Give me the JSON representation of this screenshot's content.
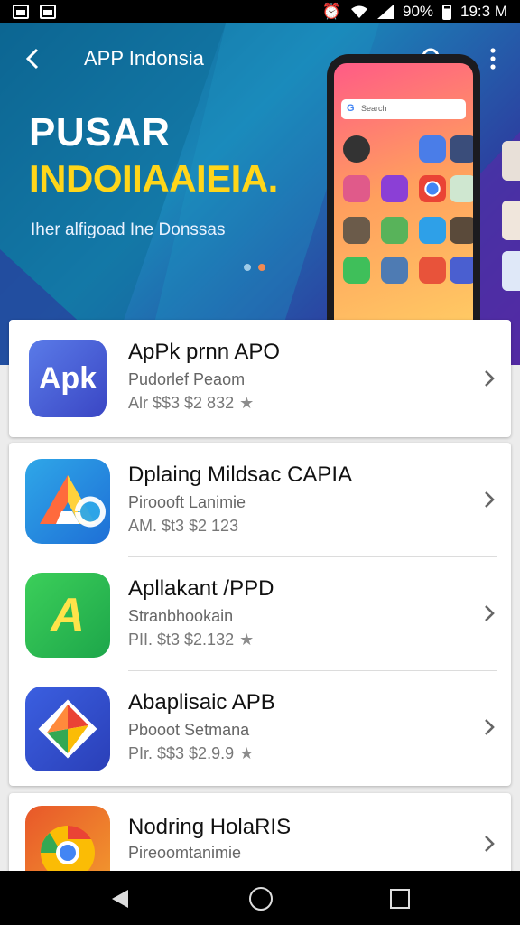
{
  "status_bar": {
    "battery": "90%",
    "time": "19:3 M"
  },
  "header": {
    "title": "APP Indonsia",
    "headline_line1": "PUSAR",
    "headline_line2": "INDOIIAAIEIA.",
    "tagline": "Iher alfigoad Ine Donssas",
    "slide_count": 2,
    "active_slide": 1
  },
  "phone": {
    "search_text": "Search"
  },
  "colors": {
    "headline_yellow": "#ffd61a",
    "dot_active": "#f08a52",
    "dot_inactive": "#9ecbe8"
  },
  "apps": [
    {
      "name": "ApPk prnn APO",
      "subtitle": "Pudorlef Peaom",
      "meta": "Alr $$3 $2 832",
      "rating_icon": "star-icon",
      "icon": "apk-icon",
      "icon_text": "Apk"
    },
    {
      "name": "Dplaing Mildsac CAPIA",
      "subtitle": "Piroooft Lanimie",
      "meta": "AM. $t3 $2 123",
      "icon": "drive-icon"
    },
    {
      "name": "Apllakant /PPD",
      "subtitle": "Stranbhookain",
      "meta": "PII. $t3 $2.132",
      "rating_icon": "star-icon",
      "icon": "green-a-icon",
      "icon_text": "A"
    },
    {
      "name": "Abaplisaic APB",
      "subtitle": "Pbooot Setmana",
      "meta": "PIr. $$3 $2.9.9",
      "rating_icon": "star-icon",
      "icon": "colorful-diamond-icon"
    },
    {
      "name": "Nodring HolaRIS",
      "subtitle": "Pireoomtanimie",
      "meta": "",
      "icon": "chrome-like-icon"
    }
  ]
}
